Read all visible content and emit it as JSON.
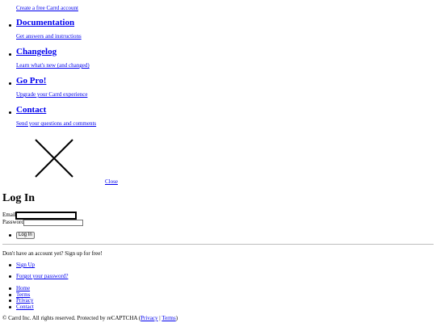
{
  "menu": {
    "items": [
      {
        "title": "",
        "desc": "Create a free Carrd account"
      },
      {
        "title": "Documentation",
        "desc": "Get answers and instructions"
      },
      {
        "title": "Changelog",
        "desc": "Learn what's new (and changed)"
      },
      {
        "title": "Go Pro!",
        "desc": "Upgrade your Carrd experience"
      },
      {
        "title": "Contact",
        "desc": "Send your questions and comments"
      }
    ],
    "close_label": "Close"
  },
  "login": {
    "title": "Log In",
    "email_label": "Email",
    "email_value": "",
    "password_label": "Password",
    "password_value": "",
    "submit_label": "Log In"
  },
  "signup": {
    "prompt": "Don't have an account yet? Sign up for free!",
    "links": [
      "Sign Up",
      "Forgot your password?"
    ]
  },
  "footer": {
    "links": [
      "Home",
      "Terms",
      "Privacy",
      "Contact"
    ],
    "copyright_prefix": "© Carrd Inc. All rights reserved. Protected by reCAPTCHA (",
    "privacy_label": "Privacy",
    "separator": " | ",
    "terms_label": "Terms",
    "copyright_suffix": ")"
  }
}
